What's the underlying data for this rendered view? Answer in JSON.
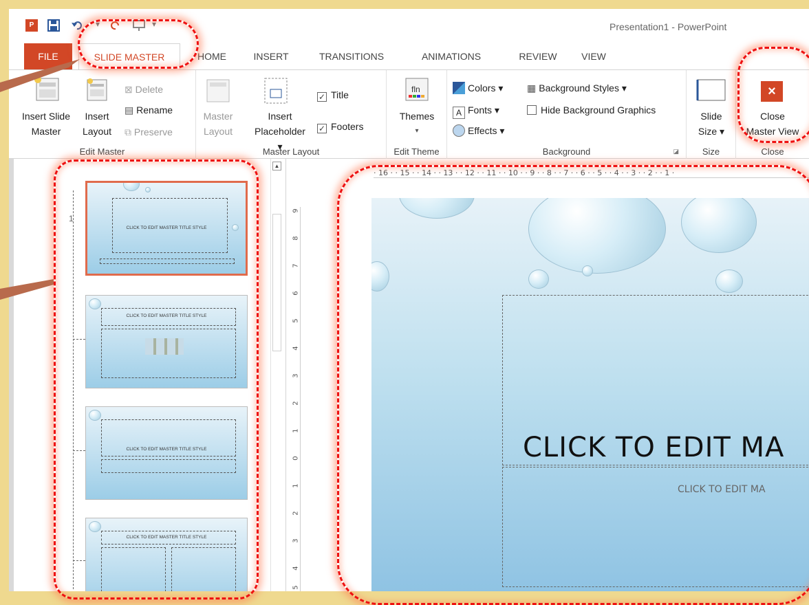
{
  "window": {
    "title": "Presentation1 - PowerPoint"
  },
  "tabs": [
    "FILE",
    "SLIDE MASTER",
    "HOME",
    "INSERT",
    "TRANSITIONS",
    "ANIMATIONS",
    "REVIEW",
    "VIEW"
  ],
  "ribbon": {
    "edit_master": {
      "label": "Edit Master",
      "insert_slide_master": [
        "Insert Slide",
        "Master"
      ],
      "insert_layout": [
        "Insert",
        "Layout"
      ],
      "delete": "Delete",
      "rename": "Rename",
      "preserve": "Preserve"
    },
    "master_layout": {
      "label": "Master Layout",
      "master_layout_btn": [
        "Master",
        "Layout"
      ],
      "insert_placeholder": [
        "Insert",
        "Placeholder ▾"
      ],
      "title_check": "Title",
      "footers_check": "Footers"
    },
    "edit_theme": {
      "label": "Edit Theme",
      "themes": "Themes"
    },
    "background": {
      "label": "Background",
      "colors": "Colors ▾",
      "fonts": "Fonts ▾",
      "effects": "Effects ▾",
      "background_styles": "Background Styles ▾",
      "hide_bg": "Hide Background Graphics"
    },
    "size": {
      "label": "Size",
      "slide_size": [
        "Slide",
        "Size ▾"
      ]
    },
    "close": {
      "label": "Close",
      "close_master": [
        "Close",
        "Master View"
      ]
    }
  },
  "thumbnails": [
    {
      "num": "1",
      "title": "CLICK TO EDIT MASTER TITLE STYLE"
    },
    {
      "num": "",
      "title": "CLICK TO EDIT MASTER TITLE STYLE"
    },
    {
      "num": "",
      "title": "CLICK TO EDIT MASTER TITLE STYLE"
    },
    {
      "num": "",
      "title": "CLICK TO EDIT MASTER TITLE STYLE"
    }
  ],
  "ruler": {
    "horizontal": "· 16 · · 15 · · 14 · · 13 · · 12 · · 11 · · 10 · · 9 · · 8 · · 7 · · 6 · · 5 · · 4 · · 3 · · 2 · · 1 ·",
    "vertical": [
      "9",
      "8",
      "7",
      "6",
      "5",
      "4",
      "3",
      "2",
      "1",
      "0",
      "1",
      "2",
      "3",
      "4",
      "5"
    ]
  },
  "slide": {
    "title": "CLICK TO EDIT MA",
    "subtitle": "CLICK TO EDIT MA"
  },
  "colors": {
    "accent": "#d24726",
    "annotation": "#e11111",
    "background": "#efd98f"
  }
}
